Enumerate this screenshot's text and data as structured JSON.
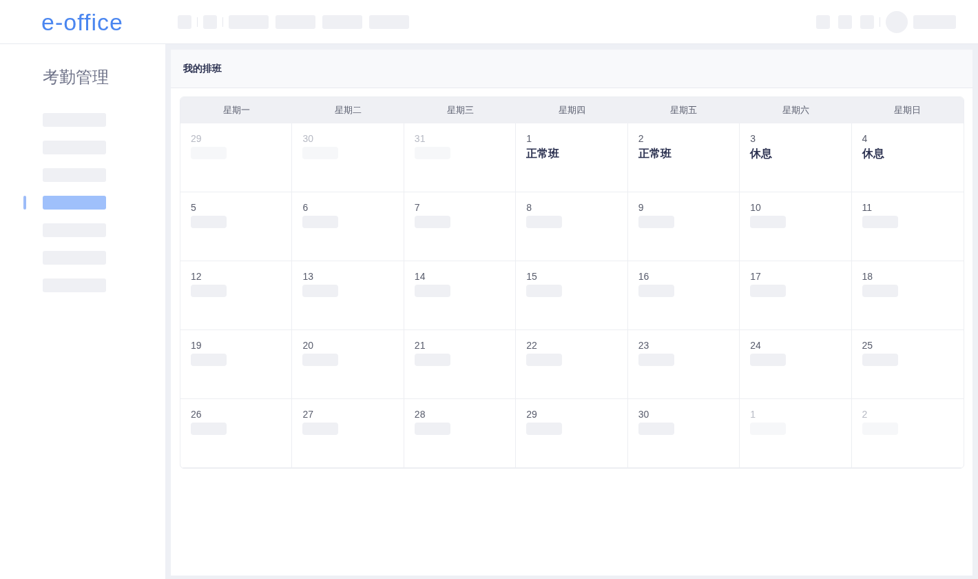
{
  "header": {
    "logo": "e-office"
  },
  "sidebar": {
    "title": "考勤管理",
    "items": [
      {
        "selected": false
      },
      {
        "selected": false
      },
      {
        "selected": false
      },
      {
        "selected": true
      },
      {
        "selected": false
      },
      {
        "selected": false
      },
      {
        "selected": false
      }
    ]
  },
  "panel": {
    "title": "我的排班"
  },
  "calendar": {
    "weekdays": [
      "星期一",
      "星期二",
      "星期三",
      "星期四",
      "星期五",
      "星期六",
      "星期日"
    ],
    "weeks": [
      [
        {
          "day": "29",
          "outside": true
        },
        {
          "day": "30",
          "outside": true
        },
        {
          "day": "31",
          "outside": true
        },
        {
          "day": "1",
          "outside": false,
          "shift": "正常班"
        },
        {
          "day": "2",
          "outside": false,
          "shift": "正常班"
        },
        {
          "day": "3",
          "outside": false,
          "shift": "休息"
        },
        {
          "day": "4",
          "outside": false,
          "shift": "休息"
        }
      ],
      [
        {
          "day": "5",
          "outside": false
        },
        {
          "day": "6",
          "outside": false
        },
        {
          "day": "7",
          "outside": false
        },
        {
          "day": "8",
          "outside": false
        },
        {
          "day": "9",
          "outside": false
        },
        {
          "day": "10",
          "outside": false
        },
        {
          "day": "11",
          "outside": false
        }
      ],
      [
        {
          "day": "12",
          "outside": false
        },
        {
          "day": "13",
          "outside": false
        },
        {
          "day": "14",
          "outside": false
        },
        {
          "day": "15",
          "outside": false
        },
        {
          "day": "16",
          "outside": false
        },
        {
          "day": "17",
          "outside": false
        },
        {
          "day": "18",
          "outside": false
        }
      ],
      [
        {
          "day": "19",
          "outside": false
        },
        {
          "day": "20",
          "outside": false
        },
        {
          "day": "21",
          "outside": false
        },
        {
          "day": "22",
          "outside": false
        },
        {
          "day": "23",
          "outside": false
        },
        {
          "day": "24",
          "outside": false
        },
        {
          "day": "25",
          "outside": false
        }
      ],
      [
        {
          "day": "26",
          "outside": false
        },
        {
          "day": "27",
          "outside": false
        },
        {
          "day": "28",
          "outside": false
        },
        {
          "day": "29",
          "outside": false
        },
        {
          "day": "30",
          "outside": false
        },
        {
          "day": "1",
          "outside": true
        },
        {
          "day": "2",
          "outside": true
        }
      ]
    ]
  }
}
